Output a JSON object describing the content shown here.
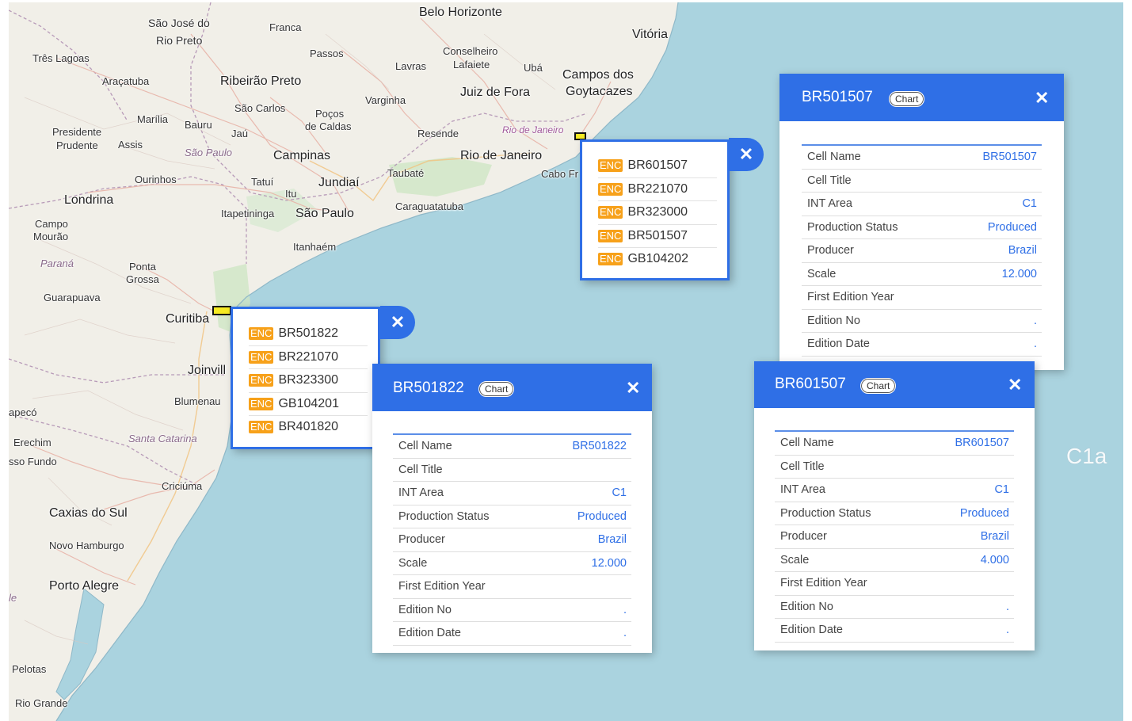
{
  "map": {
    "places": [
      {
        "id": "belo-horizonte",
        "name": "Belo Horizonte"
      },
      {
        "id": "vitoria",
        "name": "Vitória"
      },
      {
        "id": "sao-jose-rio-preto-1",
        "name": "São José do"
      },
      {
        "id": "sao-jose-rio-preto-2",
        "name": "Rio Preto"
      },
      {
        "id": "franca",
        "name": "Franca"
      },
      {
        "id": "tres-lagoas",
        "name": "Três Lagoas"
      },
      {
        "id": "passos",
        "name": "Passos"
      },
      {
        "id": "conselheiro-lafaiete-1",
        "name": "Conselheiro"
      },
      {
        "id": "conselheiro-lafaiete-2",
        "name": "Lafaiete"
      },
      {
        "id": "lavras",
        "name": "Lavras"
      },
      {
        "id": "uba",
        "name": "Ubá"
      },
      {
        "id": "aracatuba",
        "name": "Araçatuba"
      },
      {
        "id": "ribeirao-preto",
        "name": "Ribeirão Preto"
      },
      {
        "id": "campos-1",
        "name": "Campos dos"
      },
      {
        "id": "campos-2",
        "name": "Goytacazes"
      },
      {
        "id": "juiz-de-fora",
        "name": "Juiz de Fora"
      },
      {
        "id": "varginha",
        "name": "Varginha"
      },
      {
        "id": "sao-carlos",
        "name": "São Carlos"
      },
      {
        "id": "pocos-1",
        "name": "Poços"
      },
      {
        "id": "pocos-2",
        "name": "de Caldas"
      },
      {
        "id": "marilia",
        "name": "Marília"
      },
      {
        "id": "bauru",
        "name": "Bauru"
      },
      {
        "id": "jau",
        "name": "Jaú"
      },
      {
        "id": "presidente-1",
        "name": "Presidente"
      },
      {
        "id": "presidente-2",
        "name": "Prudente"
      },
      {
        "id": "assis",
        "name": "Assis"
      },
      {
        "id": "sao-paulo-state",
        "name": "São Paulo"
      },
      {
        "id": "resende",
        "name": "Resende"
      },
      {
        "id": "rio-state",
        "name": "Rio de Janeiro"
      },
      {
        "id": "campinas",
        "name": "Campinas"
      },
      {
        "id": "rio-de-janeiro",
        "name": "Rio de Janeiro"
      },
      {
        "id": "ourinhos",
        "name": "Ourinhos"
      },
      {
        "id": "tatui",
        "name": "Tatuí"
      },
      {
        "id": "jundiai",
        "name": "Jundiaí"
      },
      {
        "id": "taubate",
        "name": "Taubaté"
      },
      {
        "id": "cabo-frio",
        "name": "Cabo Fr"
      },
      {
        "id": "itu",
        "name": "Itu"
      },
      {
        "id": "londrina",
        "name": "Londrina"
      },
      {
        "id": "caraguatatuba",
        "name": "Caraguatatuba"
      },
      {
        "id": "itapetininga",
        "name": "Itapetininga"
      },
      {
        "id": "sao-paulo",
        "name": "São Paulo"
      },
      {
        "id": "campo-mourao-1",
        "name": "Campo"
      },
      {
        "id": "campo-mourao-2",
        "name": "Mourão"
      },
      {
        "id": "itanhaem",
        "name": "Itanhaém"
      },
      {
        "id": "parana-state",
        "name": "Paraná"
      },
      {
        "id": "ponta-grossa-1",
        "name": "Ponta"
      },
      {
        "id": "ponta-grossa-2",
        "name": "Grossa"
      },
      {
        "id": "guarapuava",
        "name": "Guarapuava"
      },
      {
        "id": "curitiba",
        "name": "Curitiba"
      },
      {
        "id": "joinville",
        "name": "Joinvill"
      },
      {
        "id": "blumenau",
        "name": "Blumenau"
      },
      {
        "id": "chapeco",
        "name": "apecó"
      },
      {
        "id": "erechim",
        "name": "Erechim"
      },
      {
        "id": "santa-catarina",
        "name": "Santa Catarina"
      },
      {
        "id": "passo-fundo",
        "name": "sso Fundo"
      },
      {
        "id": "criciuma",
        "name": "Criciúma"
      },
      {
        "id": "caxias",
        "name": "Caxias do Sul"
      },
      {
        "id": "novo-hamburgo",
        "name": "Novo Hamburgo"
      },
      {
        "id": "porto-alegre",
        "name": "Porto Alegre"
      },
      {
        "id": "le",
        "name": "le"
      },
      {
        "id": "pelotas",
        "name": "Pelotas"
      },
      {
        "id": "rio-grande",
        "name": "Rio Grande"
      }
    ],
    "cell_label": "C1a"
  },
  "popups": {
    "rio": {
      "items": [
        {
          "badge": "ENC",
          "code": "BR601507"
        },
        {
          "badge": "ENC",
          "code": "BR221070"
        },
        {
          "badge": "ENC",
          "code": "BR323000"
        },
        {
          "badge": "ENC",
          "code": "BR501507"
        },
        {
          "badge": "ENC",
          "code": "GB104202"
        }
      ],
      "close_label": "✕"
    },
    "curitiba": {
      "items": [
        {
          "badge": "ENC",
          "code": "BR501822"
        },
        {
          "badge": "ENC",
          "code": "BR221070"
        },
        {
          "badge": "ENC",
          "code": "BR323300"
        },
        {
          "badge": "ENC",
          "code": "GB104201"
        },
        {
          "badge": "ENC",
          "code": "BR401820"
        }
      ],
      "close_label": "✕"
    }
  },
  "cards": {
    "br501507": {
      "title": "BR501507",
      "chip": "Chart",
      "close_label": "✕",
      "rows": [
        {
          "key": "Cell Name",
          "value": "BR501507"
        },
        {
          "key": "Cell Title",
          "value": ""
        },
        {
          "key": "INT Area",
          "value": "C1"
        },
        {
          "key": "Production Status",
          "value": "Produced"
        },
        {
          "key": "Producer",
          "value": "Brazil"
        },
        {
          "key": "Scale",
          "value": "12.000"
        },
        {
          "key": "First Edition Year",
          "value": ""
        },
        {
          "key": "Edition No",
          "value": "."
        },
        {
          "key": "Edition Date",
          "value": "."
        }
      ]
    },
    "br501822": {
      "title": "BR501822",
      "chip": "Chart",
      "close_label": "✕",
      "rows": [
        {
          "key": "Cell Name",
          "value": "BR501822"
        },
        {
          "key": "Cell Title",
          "value": ""
        },
        {
          "key": "INT Area",
          "value": "C1"
        },
        {
          "key": "Production Status",
          "value": "Produced"
        },
        {
          "key": "Producer",
          "value": "Brazil"
        },
        {
          "key": "Scale",
          "value": "12.000"
        },
        {
          "key": "First Edition Year",
          "value": ""
        },
        {
          "key": "Edition No",
          "value": "."
        },
        {
          "key": "Edition Date",
          "value": "."
        }
      ]
    },
    "br601507": {
      "title": "BR601507",
      "chip": "Chart",
      "close_label": "✕",
      "rows": [
        {
          "key": "Cell Name",
          "value": "BR601507"
        },
        {
          "key": "Cell Title",
          "value": ""
        },
        {
          "key": "INT Area",
          "value": "C1"
        },
        {
          "key": "Production Status",
          "value": "Produced"
        },
        {
          "key": "Producer",
          "value": "Brazil"
        },
        {
          "key": "Scale",
          "value": "4.000"
        },
        {
          "key": "First Edition Year",
          "value": ""
        },
        {
          "key": "Edition No",
          "value": "."
        },
        {
          "key": "Edition Date",
          "value": "."
        }
      ]
    }
  },
  "colors": {
    "land": "#f1efe8",
    "sea": "#aad3df",
    "accent": "#2f6fe6",
    "badge": "#f7a11a",
    "marker": "#f6ea23"
  }
}
